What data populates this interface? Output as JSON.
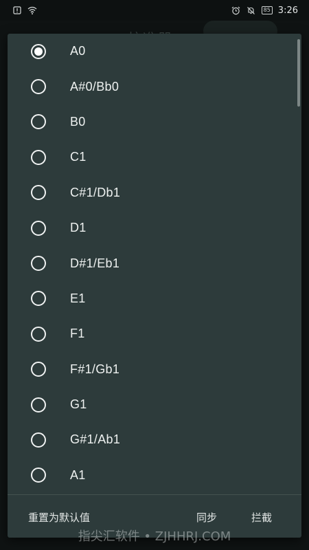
{
  "status_bar": {
    "time": "3:26",
    "battery": "85",
    "icons": [
      "alert-icon",
      "wifi-icon",
      "alarm-icon",
      "mute-icon",
      "battery-icon"
    ]
  },
  "background": {
    "title": "校准器"
  },
  "dialog": {
    "options": [
      {
        "label": "A0",
        "checked": true
      },
      {
        "label": "A#0/Bb0",
        "checked": false
      },
      {
        "label": "B0",
        "checked": false
      },
      {
        "label": "C1",
        "checked": false
      },
      {
        "label": "C#1/Db1",
        "checked": false
      },
      {
        "label": "D1",
        "checked": false
      },
      {
        "label": "D#1/Eb1",
        "checked": false
      },
      {
        "label": "E1",
        "checked": false
      },
      {
        "label": "F1",
        "checked": false
      },
      {
        "label": "F#1/Gb1",
        "checked": false
      },
      {
        "label": "G1",
        "checked": false
      },
      {
        "label": "G#1/Ab1",
        "checked": false
      },
      {
        "label": "A1",
        "checked": false
      }
    ],
    "actions": {
      "reset": "重置为默认值",
      "sync": "同步",
      "block": "拦截"
    }
  },
  "watermark": "指尖汇软件 • ZJHHRJ.COM",
  "colors": {
    "dialog_bg": "#2d3b3b",
    "screen_bg": "#0f1313",
    "radio": "#f0f2f2"
  }
}
